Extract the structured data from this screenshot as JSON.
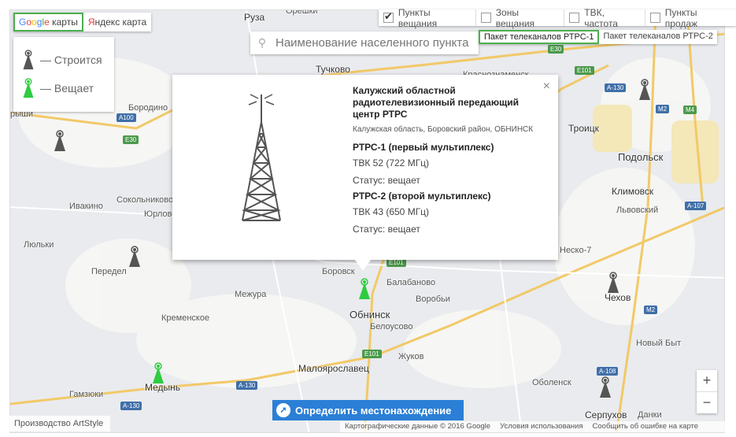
{
  "map_tabs": {
    "google": "Google",
    "google_suffix": " карты",
    "yandex_y": "Я",
    "yandex_rest": "ндекс карта"
  },
  "legend": {
    "building": "— Строится",
    "broadcasting": "— Вещает"
  },
  "filters": [
    {
      "label": "Пункты вещания",
      "checked": true
    },
    {
      "label": "Зоны вещания",
      "checked": false
    },
    {
      "label": "ТВК, частота",
      "checked": false
    },
    {
      "label": "Пункты продаж",
      "checked": false
    }
  ],
  "search": {
    "placeholder": "Наименование населенного пункта"
  },
  "packages": {
    "p1": "Пакет телеканалов РТРС-1",
    "p2": "Пакет телеканалов РТРС-2"
  },
  "popup": {
    "title": "Калужский областной радиотелевизионный передающий центр РТРС",
    "address": "Калужская область, Боровский район, ОБНИНСК",
    "mux1_title": "РТРС-1 (первый мультиплекс)",
    "mux1_channel": "ТВК 52 (722 МГц)",
    "mux1_status": "Статус: вещает",
    "mux2_title": "РТРС-2 (второй мультиплекс)",
    "mux2_channel": "ТВК 43 (650 МГц)",
    "mux2_status": "Статус: вещает",
    "close": "×"
  },
  "locate_button": "Определить местонахождение",
  "zoom": {
    "in": "+",
    "out": "−"
  },
  "footer": {
    "producer": "Производство ArtStyle",
    "map_data": "Картографические данные © 2016 Google",
    "terms": "Условия использования",
    "report": "Сообщить об ошибке на карте"
  },
  "places": {
    "ruza": "Руза",
    "oreshki": "Орешки",
    "tuchkovo": "Тучково",
    "krasnoznamensk": "Краснознаменск",
    "borodino": "Бородино",
    "ryshi": "рыши",
    "troitsk": "Троицк",
    "podolsk": "Подольск",
    "ivakino": "Ивакино",
    "sokolnikovo": "Сокольниково",
    "yurlovo": "Юрлово",
    "klimovsk": "Климовск",
    "lvovsky": "Львовский",
    "lyulki": "Люльки",
    "peredel": "Передел",
    "nesko7": "Неско-7",
    "borovsk": "Боровск",
    "balabanovo": "Балабаново",
    "mezhura": "Межура",
    "vorobi": "Воробьи",
    "chekhov": "Чехов",
    "kremenskoe": "Кременское",
    "obninsk": "Обнинск",
    "belousovo": "Белоусово",
    "zhukov": "Жуков",
    "novy_byt": "Новый Быт",
    "maloyaroslavets": "Малоярославец",
    "medyn": "Медынь",
    "gamzyuki": "Гамзюки",
    "obolenek": "Оболенск",
    "serpukhov": "Серпухов",
    "danki": "Данки"
  },
  "shields": {
    "a100": "A100",
    "e30a": "E30",
    "e30b": "E30",
    "a130a": "A-130",
    "a130b": "A-130",
    "a130c": "A-130",
    "m2": "M2",
    "m4": "M4",
    "e101a": "E101",
    "e101b": "E101",
    "e101c": "E101",
    "a107": "A-107",
    "a108": "A-108",
    "m2b": "M2"
  },
  "colors": {
    "building": "#555555",
    "broadcasting": "#2ecc40",
    "accent": "#2b7fd6",
    "active_border": "#4caf50"
  }
}
